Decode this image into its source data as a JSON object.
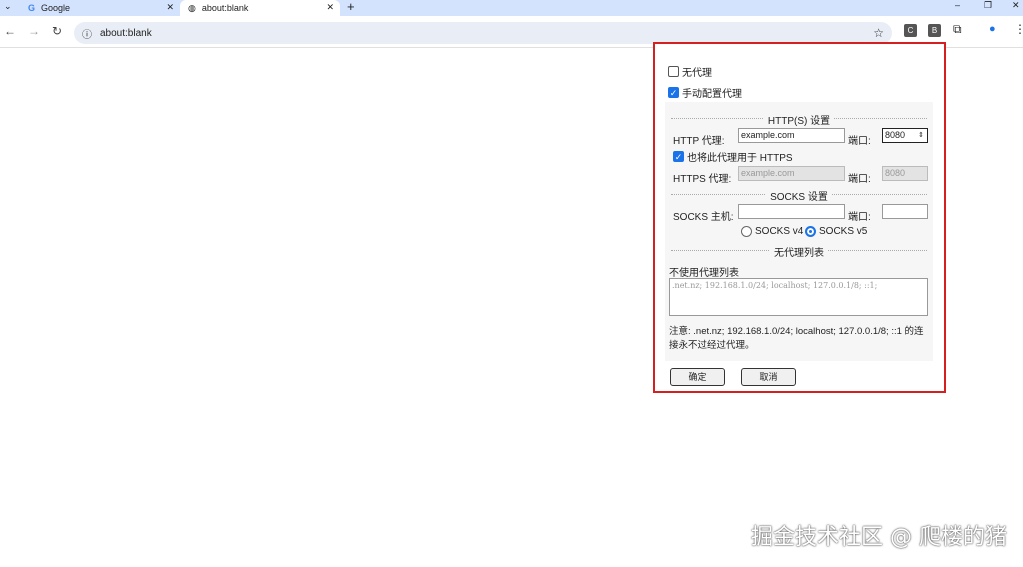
{
  "browser": {
    "tabs": [
      {
        "title": "Google"
      },
      {
        "title": "about:blank"
      }
    ],
    "url": "about:blank",
    "ext_c": "C",
    "ext_b": "B"
  },
  "proxy": {
    "no_proxy": "无代理",
    "manual": "手动配置代理",
    "http_section": "HTTP(S) 设置",
    "http_label": "HTTP 代理:",
    "http_value": "example.com",
    "port_label": "端口:",
    "http_port": "8080",
    "use_for_https": "也将此代理用于 HTTPS",
    "https_label": "HTTPS 代理:",
    "https_value": "example.com",
    "https_port": "8080",
    "socks_section": "SOCKS 设置",
    "socks_label": "SOCKS 主机:",
    "socks_v4": "SOCKS v4",
    "socks_v5": "SOCKS v5",
    "bypass_section": "无代理列表",
    "bypass_label": "不使用代理列表",
    "bypass_placeholder": ".net.nz; 192.168.1.0/24; localhost; 127.0.0.1/8; ::1;",
    "note": "注意: .net.nz; 192.168.1.0/24; localhost; 127.0.0.1/8; ::1 的连接永不过经过代理。",
    "ok": "确定",
    "cancel": "取消"
  },
  "watermark": "掘金技术社区 @ 爬楼的猪"
}
